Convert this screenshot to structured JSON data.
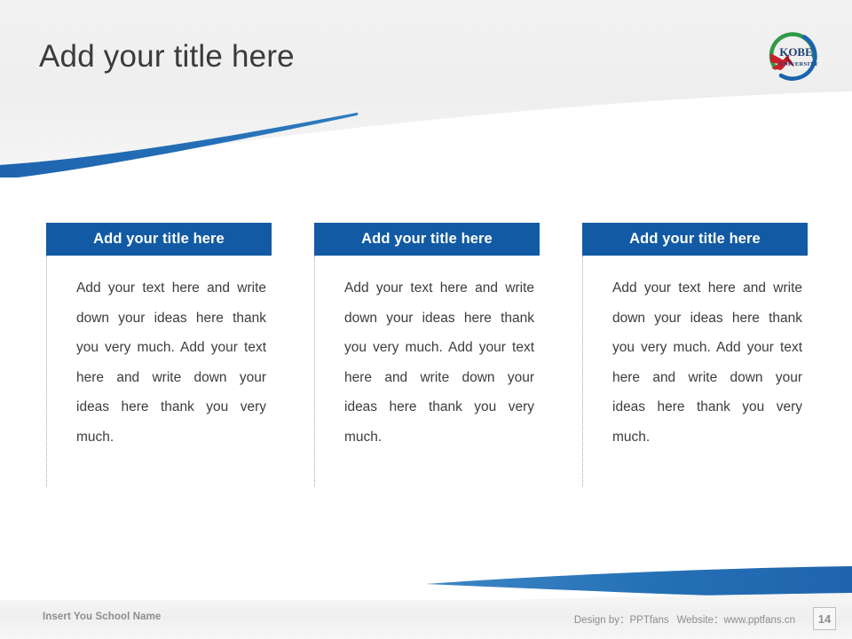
{
  "slide": {
    "title": "Add your title here",
    "page_number": "14",
    "accent_color": "#125AA3",
    "title_color": "#3b3b3b",
    "footer_text_color": "#8d8d8d"
  },
  "logo": {
    "name": "kobe-university-logo",
    "line1": "KOBE",
    "line2": "UNIVERSITY",
    "green": "#2e9b48",
    "blue": "#1b63ad",
    "red": "#c8202c",
    "text_color": "#1b3f72"
  },
  "cards": [
    {
      "header": "Add your title here",
      "body": "Add your text here and write down your ideas here thank you very much. Add your text here and write down your ideas here thank you very much."
    },
    {
      "header": "Add your title here",
      "body": "Add your text here and write down your ideas here thank you very much. Add your text here and write down your ideas here thank you very much."
    },
    {
      "header": "Add your title here",
      "body": "Add your text here and write down your ideas here thank you very much. Add your text here and write down your ideas here thank you very much."
    }
  ],
  "footer": {
    "school_name": "Insert You School Name",
    "design_by_label": "Design by：PPTfans",
    "website_label": "Website：www.pptfans.cn"
  }
}
